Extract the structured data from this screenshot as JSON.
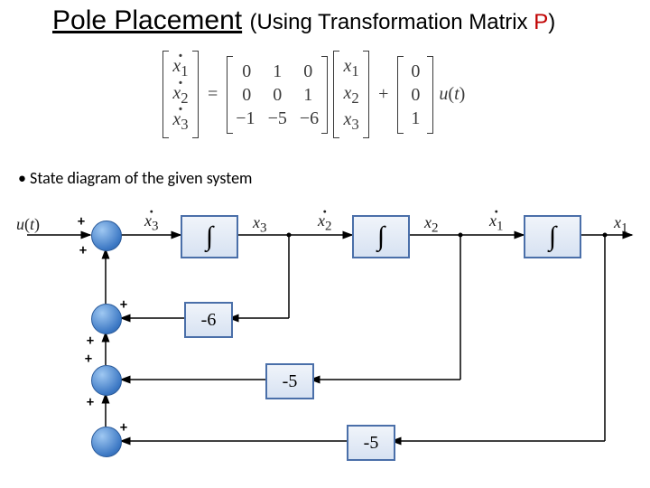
{
  "title": {
    "main": "Pole Placement",
    "sub_prefix": "(Using Transformation Matrix ",
    "p": "P",
    "sub_suffix": ")"
  },
  "bullet": "State diagram of the given system",
  "equation": {
    "xdot": [
      "x1",
      "x2",
      "x3"
    ],
    "A": [
      [
        "0",
        "1",
        "0"
      ],
      [
        "0",
        "0",
        "1"
      ],
      [
        "−1",
        "−5",
        "−6"
      ]
    ],
    "x": [
      "x1",
      "x2",
      "x3"
    ],
    "B": [
      "0",
      "0",
      "1"
    ],
    "u": "u(t)",
    "eq": "=",
    "plus": "+"
  },
  "diagram": {
    "input": "u(t)",
    "integrator": "∫",
    "gains": {
      "g1": "-6",
      "g2": "-5",
      "g3": "-5"
    },
    "signals": {
      "x3dot": "x3",
      "x3": "x3",
      "x2dot": "x2",
      "x2": "x2",
      "x1dot": "x1",
      "x1": "x1"
    },
    "plus": "+"
  }
}
